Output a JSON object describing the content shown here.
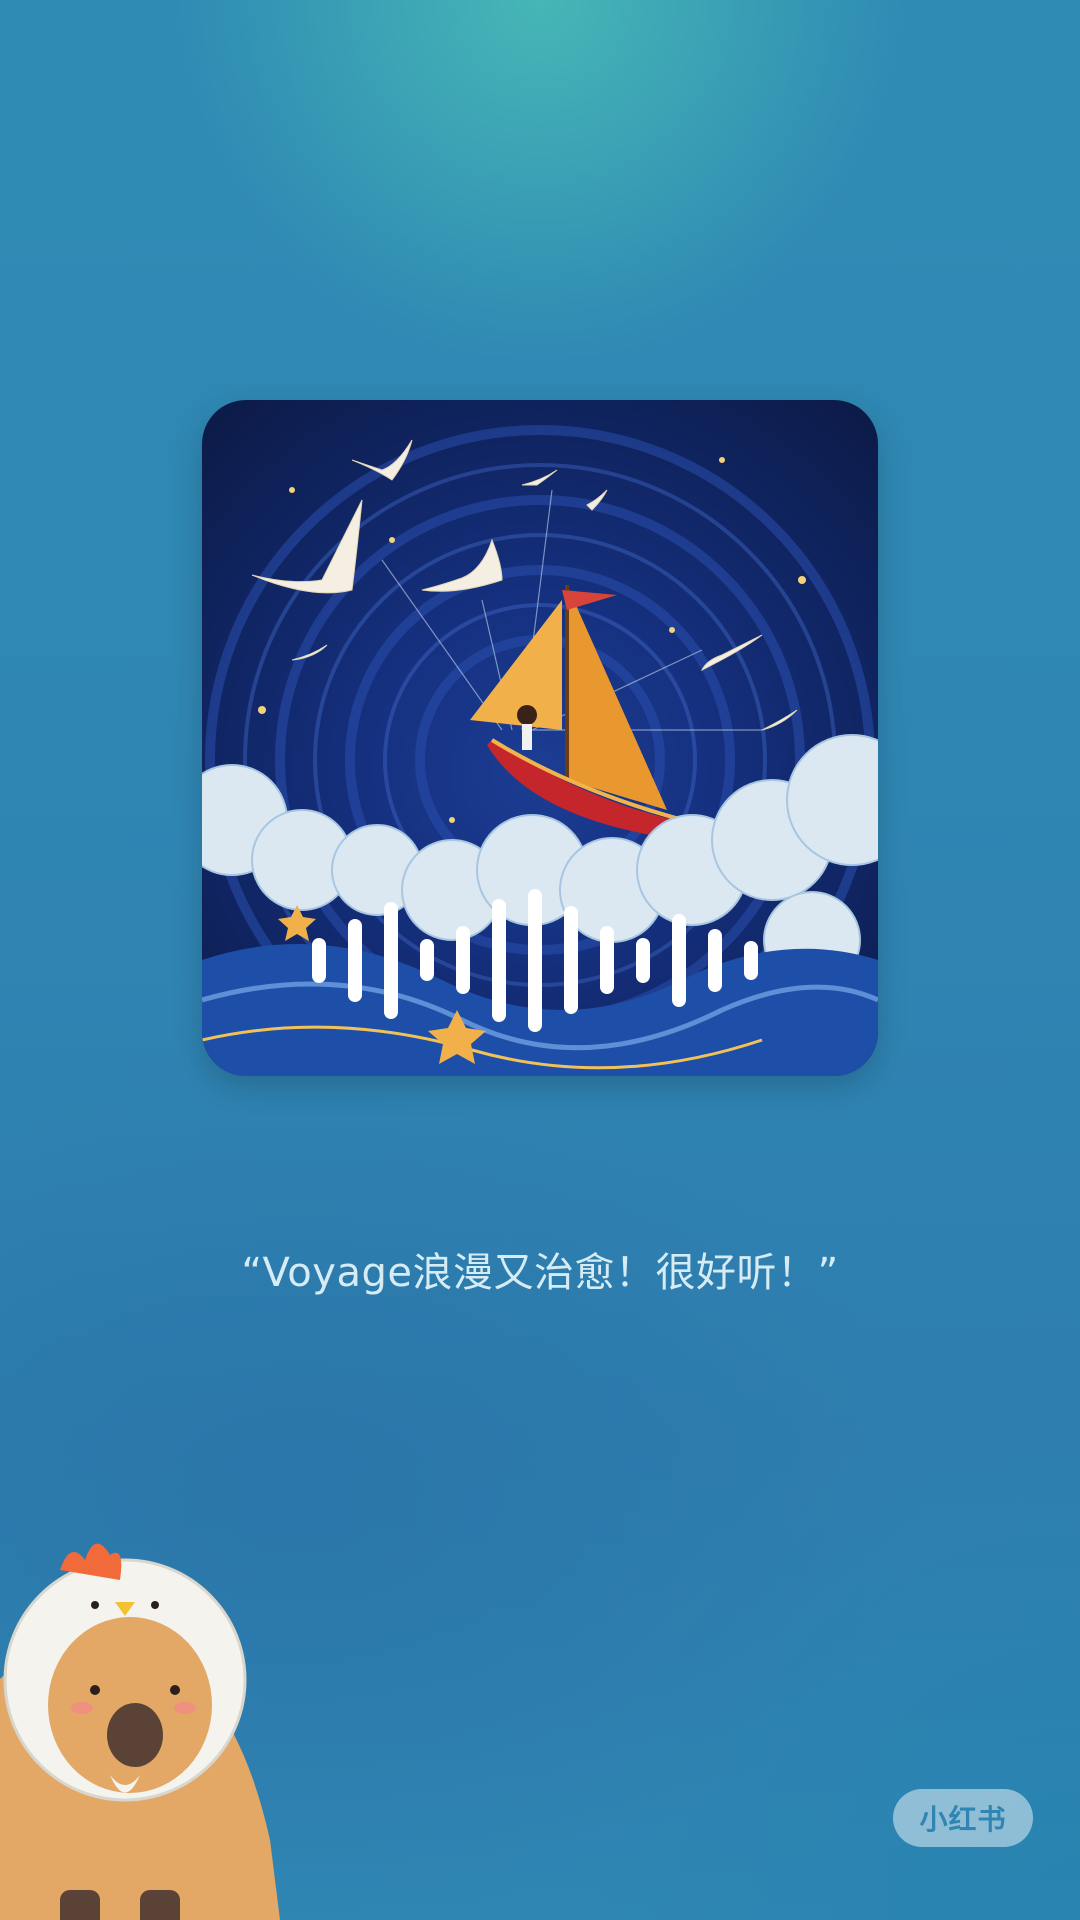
{
  "quote": "“Voyage浪漫又治愈！很好听！”",
  "watermark": "小红书",
  "cover": {
    "icon": "sailboat-artwork",
    "colors": {
      "sky": "#15307f",
      "sail": "#f0a23a",
      "hull": "#c4262c",
      "clouds": "#dbe8f2"
    }
  },
  "waveform": {
    "icon": "audio-waveform-icon",
    "levels": [
      0.3,
      0.55,
      0.78,
      0.28,
      0.45,
      0.82,
      0.95,
      0.72,
      0.45,
      0.3,
      0.62,
      0.42,
      0.26
    ]
  },
  "mascot": {
    "icon": "capybara-chicken-hat-sticker"
  },
  "colors": {
    "background": "#2f86b3",
    "quote_text": "#d6ecf4"
  }
}
